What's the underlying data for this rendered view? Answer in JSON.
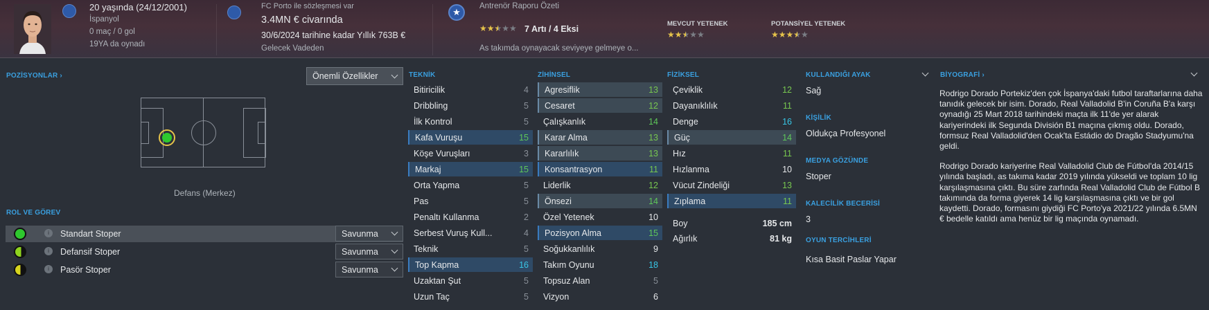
{
  "header": {
    "age": "20 yaşında (24/12/2001)",
    "nationality": "İspanyol",
    "caps": "0 maç / 0 gol",
    "youth_games": "19YA da oynadı",
    "contract_note": "FC Porto ile sözleşmesi var",
    "value": "3.4MN € civarında",
    "contract_until": "30/6/2024 tarihine kadar Yıllık 763B €",
    "future_status": "Gelecek Vadeden",
    "coach_report_title": "Antrenör Raporu Özeti",
    "report_summary": "7 Artı / 4 Eksi",
    "report_rating": 2.5,
    "report_note": "As takımda oynayacak seviyeye gelmeye o...",
    "current_ability_label": "MEVCUT YETENEK",
    "current_ability_stars": 2.5,
    "potential_ability_label": "POTANSİYEL YETENEK",
    "potential_ability_stars": 3.5
  },
  "positions": {
    "title": "POZİSYONLAR",
    "filter_label": "Önemli Özellikler",
    "position_name": "Defans (Merkez)"
  },
  "roles": {
    "title": "ROL VE GÖREV",
    "items": [
      {
        "name": "Standart Stoper",
        "duty": "Savunma"
      },
      {
        "name": "Defansif Stoper",
        "duty": "Savunma"
      },
      {
        "name": "Pasör Stoper",
        "duty": "Savunma"
      }
    ]
  },
  "technical": {
    "title": "TEKNİK",
    "rows": [
      {
        "name": "Bitiricilik",
        "value": "4"
      },
      {
        "name": "Dribbling",
        "value": "5"
      },
      {
        "name": "İlk Kontrol",
        "value": "5"
      },
      {
        "name": "Kafa Vuruşu",
        "value": "15"
      },
      {
        "name": "Köşe Vuruşları",
        "value": "3"
      },
      {
        "name": "Markaj",
        "value": "15"
      },
      {
        "name": "Orta Yapma",
        "value": "5"
      },
      {
        "name": "Pas",
        "value": "5"
      },
      {
        "name": "Penaltı Kullanma",
        "value": "2"
      },
      {
        "name": "Serbest Vuruş Kull...",
        "value": "4"
      },
      {
        "name": "Teknik",
        "value": "5"
      },
      {
        "name": "Top Kapma",
        "value": "16"
      },
      {
        "name": "Uzaktan Şut",
        "value": "5"
      },
      {
        "name": "Uzun Taç",
        "value": "5"
      }
    ]
  },
  "mental": {
    "title": "ZİHİNSEL",
    "rows": [
      {
        "name": "Agresiflik",
        "value": "13"
      },
      {
        "name": "Cesaret",
        "value": "12"
      },
      {
        "name": "Çalışkanlık",
        "value": "14"
      },
      {
        "name": "Karar Alma",
        "value": "13"
      },
      {
        "name": "Kararlılık",
        "value": "13"
      },
      {
        "name": "Konsantrasyon",
        "value": "11"
      },
      {
        "name": "Liderlik",
        "value": "12"
      },
      {
        "name": "Önsezi",
        "value": "14"
      },
      {
        "name": "Özel Yetenek",
        "value": "10"
      },
      {
        "name": "Pozisyon Alma",
        "value": "15"
      },
      {
        "name": "Soğukkanlılık",
        "value": "9"
      },
      {
        "name": "Takım Oyunu",
        "value": "18"
      },
      {
        "name": "Topsuz Alan",
        "value": "5"
      },
      {
        "name": "Vizyon",
        "value": "6"
      }
    ]
  },
  "physical": {
    "title": "FİZİKSEL",
    "rows": [
      {
        "name": "Çeviklik",
        "value": "12"
      },
      {
        "name": "Dayanıklılık",
        "value": "11"
      },
      {
        "name": "Denge",
        "value": "16"
      },
      {
        "name": "Güç",
        "value": "14"
      },
      {
        "name": "Hız",
        "value": "11"
      },
      {
        "name": "Hızlanma",
        "value": "10"
      },
      {
        "name": "Vücut Zindeliği",
        "value": "13"
      },
      {
        "name": "Zıplama",
        "value": "11"
      }
    ],
    "height_label": "Boy",
    "height_value": "185 cm",
    "weight_label": "Ağırlık",
    "weight_value": "81 kg"
  },
  "side": {
    "foot_title": "KULLANDIĞI AYAK",
    "foot_value": "Sağ",
    "personality_title": "KİŞİLİK",
    "personality_value": "Oldukça Profesyonel",
    "media_title": "MEDYA GÖZÜNDE",
    "media_value": "Stoper",
    "gk_title": "KALECİLİK BECERİSİ",
    "gk_value": "3",
    "pref_title": "OYUN TERCİHLERİ",
    "pref_value": "Kısa Basit Paslar Yapar"
  },
  "bio": {
    "title": "BİYOGRAFİ",
    "p1": "Rodrigo Dorado Portekiz'den çok İspanya'daki futbol taraftarlarına daha tanıdık gelecek bir isim. Dorado, Real Valladolid B'in Coruña B'a karşı oynadığı 25 Mart 2018 tarihindeki maçta ilk 11'de yer alarak kariyerindeki ilk Segunda División B1 maçına çıkmış oldu. Dorado, formsuz Real Valladolid'den Ocak'ta Estádio do Dragão Stadyumu'na geldi.",
    "p2": "Rodrigo Dorado kariyerine Real Valladolid Club de Fútbol'da 2014/15 yılında başladı, as takıma kadar 2019 yılında yükseldi ve toplam 10 lig karşılaşmasına çıktı. Bu süre zarfında Real Valladolid Club de Fútbol B takımında da forma giyerek 14 lig karşılaşmasına çıktı ve bir gol kaydetti. Dorado, formasını giydiği FC Porto'ya 2021/22 yılında 6.5MN € bedelle katıldı ama henüz bir lig maçında oynamadı."
  },
  "colors": {
    "accent": "#3aa0e0",
    "highlight_row": "#2f4a66",
    "value_high": "#38c6e6",
    "value_good": "#5ec85a"
  }
}
